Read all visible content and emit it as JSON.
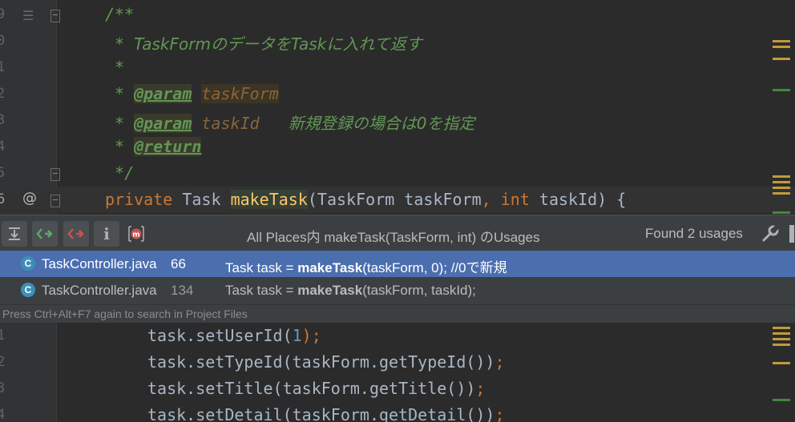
{
  "top_editor": {
    "lines": [
      {
        "num": "9",
        "text": "/**"
      },
      {
        "num": "0",
        "prefix": " * ",
        "text": "TaskFormのデータをTaskに入れて返す"
      },
      {
        "num": "1",
        "prefix": " *"
      },
      {
        "num": "2",
        "prefix": " * ",
        "tag": "@param",
        "param": "taskForm"
      },
      {
        "num": "3",
        "prefix": " * ",
        "tag": "@param",
        "param": "taskId",
        "desc": "新規登録の場合は0を指定"
      },
      {
        "num": "4",
        "prefix": " * ",
        "tag": "@return"
      },
      {
        "num": "5",
        "text": " */"
      },
      {
        "num": "6",
        "gutter_symbol": "@",
        "kw_private": "private",
        "type": "Task",
        "method": "makeTask",
        "sig_a": "(TaskForm taskForm",
        "comma": ",",
        "kw_int": "int",
        "sig_b": "taskId) {"
      }
    ]
  },
  "usages": {
    "title": "All Places内 makeTask(TaskForm, int) のUsages",
    "found": "Found 2 usages",
    "class_icon_letter": "C",
    "toolbar_icons": [
      "expand-icon",
      "next-occurrence-icon",
      "prev-occurrence-icon",
      "info-icon",
      "method-icon",
      "wrench-icon"
    ],
    "rows": [
      {
        "file": "TaskController.java",
        "line": "66",
        "pre": "Task task = ",
        "method": "makeTask",
        "post": "(taskForm, 0); //0で新規"
      },
      {
        "file": "TaskController.java",
        "line": "134",
        "pre": "Task task = ",
        "method": "makeTask",
        "post": "(taskForm, taskId);"
      }
    ],
    "hint": "Press Ctrl+Alt+F7 again to search in Project Files"
  },
  "bottom_editor": {
    "lines": [
      {
        "num": "1",
        "obj": "task.setUserId(",
        "num_lit": "1",
        "end": ");"
      },
      {
        "num": "2",
        "obj": "task.setTypeId(taskForm.getTypeId())",
        "end": ";"
      },
      {
        "num": "3",
        "obj": "task.setTitle(taskForm.getTitle())",
        "end": ";"
      },
      {
        "num": "4",
        "obj": "task.setDetail(taskForm.getDetail())",
        "end": ";"
      }
    ]
  },
  "colors": {
    "comment": "#629755",
    "keyword": "#cc7832",
    "method_highlight": "#ffc66d",
    "selection": "#4b6eaf",
    "scrollbar_warning": "#c29a3a",
    "scrollbar_ok": "#3d8a3d"
  }
}
